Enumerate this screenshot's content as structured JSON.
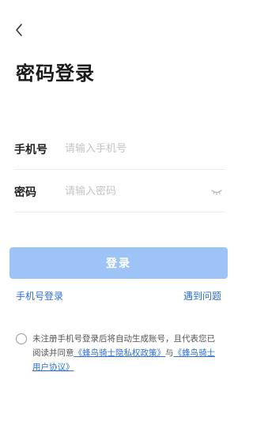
{
  "header": {
    "back_icon": "chevron-left-icon"
  },
  "title": "密码登录",
  "form": {
    "phone_label": "手机号",
    "phone_placeholder": "请输入手机号",
    "password_label": "密码",
    "password_placeholder": "请输入密码",
    "toggle_icon": "eye-closed-icon"
  },
  "login_button": "登录",
  "links": {
    "phone_login": "手机号登录",
    "help": "遇到问题"
  },
  "agreement": {
    "prefix": "未注册手机号登录后将自动生成账号，且代表您已阅读并同意",
    "privacy_link": "《蜂鸟骑士隐私权政策》",
    "joiner": "与",
    "terms_link": "《蜂鸟骑士用户协议》"
  },
  "colors": {
    "accent": "#2d6fd8",
    "button_disabled": "#9ec3f6"
  }
}
